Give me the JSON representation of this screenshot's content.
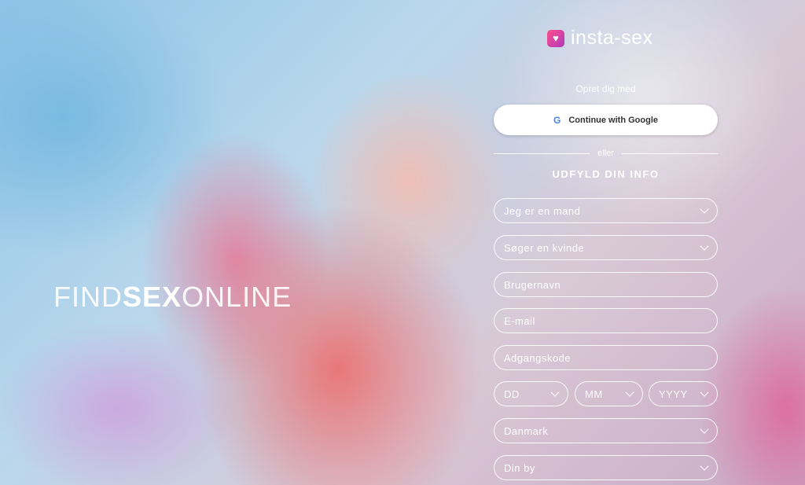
{
  "brand": {
    "find": "FIND",
    "sex": "SEX",
    "online": "ONLINE"
  },
  "logo": {
    "text": "insta-sex",
    "icon": "house-heart-icon"
  },
  "signup": {
    "subtitle": "Opret dig med",
    "google_label": "Continue with Google",
    "divider_text": "eller",
    "section_title": "UDFYLD DIN INFO"
  },
  "form": {
    "gender": "Jeg er en mand",
    "seeking": "Søger en kvinde",
    "username_placeholder": "Brugernavn",
    "email_placeholder": "E-mail",
    "password_placeholder": "Adgangskode",
    "day": "DD",
    "month": "MM",
    "year": "YYYY",
    "country": "Danmark",
    "city": "Din by"
  },
  "colors": {
    "accent": "#e0449a",
    "field_border": "#ffffff"
  }
}
